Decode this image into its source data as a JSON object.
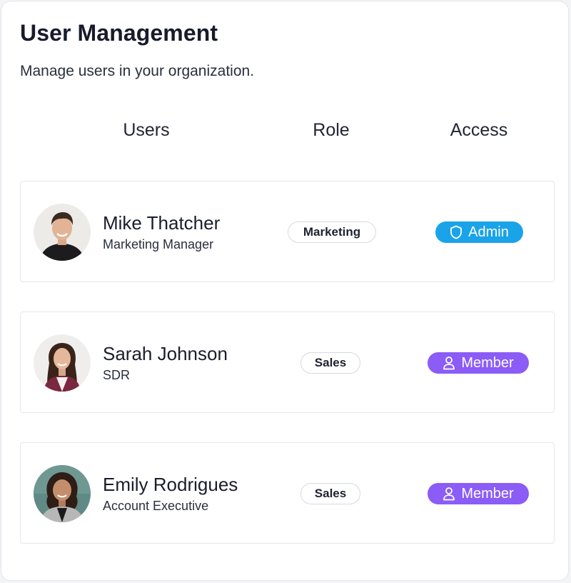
{
  "page": {
    "title": "User Management",
    "subtitle": "Manage users in your organization."
  },
  "columns": [
    "Users",
    "Role",
    "Access"
  ],
  "colors": {
    "admin": "#1aa3e8",
    "member": "#8b5cf6"
  },
  "users": [
    {
      "name": "Mike Thatcher",
      "title": "Marketing Manager",
      "role": "Marketing",
      "access": "Admin",
      "access_icon": "shield-icon"
    },
    {
      "name": "Sarah Johnson",
      "title": "SDR",
      "role": "Sales",
      "access": "Member",
      "access_icon": "person-icon"
    },
    {
      "name": "Emily Rodrigues",
      "title": "Account Executive",
      "role": "Sales",
      "access": "Member",
      "access_icon": "person-icon"
    }
  ]
}
